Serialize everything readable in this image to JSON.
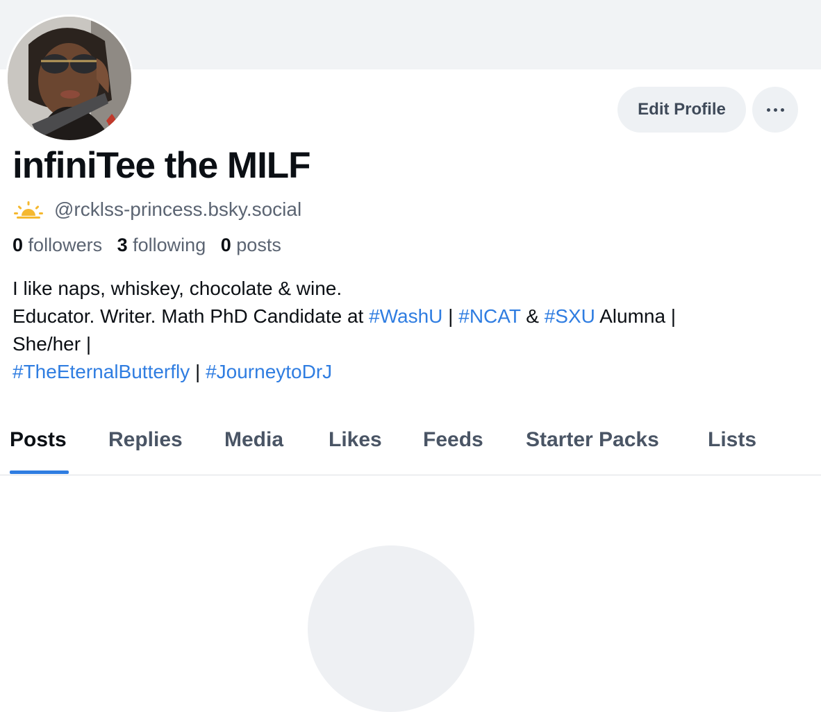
{
  "profile": {
    "display_name": "infiniTee the MILF",
    "handle": "@rcklss-princess.bsky.social",
    "handle_icon": "sun-icon"
  },
  "actions": {
    "edit_label": "Edit Profile",
    "more_icon": "more-dots-icon"
  },
  "stats": {
    "followers_count": "0",
    "followers_label": "followers",
    "following_count": "3",
    "following_label": "following",
    "posts_count": "0",
    "posts_label": "posts"
  },
  "bio": {
    "line1": "I like naps, whiskey, chocolate & wine.",
    "l2_a": "Educator. Writer. Math PhD Candidate at ",
    "tag_washu": "#WashU",
    "l2_b": " | ",
    "tag_ncat": "#NCAT",
    "l2_c": " & ",
    "tag_sxu": "#SXU",
    "l2_d": " Alumna |",
    "line3": "She/her |",
    "tag_butterfly": "#TheEternalButterfly",
    "l4_sep": " | ",
    "tag_journey": "#JourneytoDrJ"
  },
  "tabs": [
    {
      "label": "Posts",
      "active": true
    },
    {
      "label": "Replies",
      "active": false
    },
    {
      "label": "Media",
      "active": false
    },
    {
      "label": "Likes",
      "active": false
    },
    {
      "label": "Feeds",
      "active": false
    },
    {
      "label": "Starter Packs",
      "active": false
    },
    {
      "label": "Lists",
      "active": false
    }
  ],
  "colors": {
    "accent": "#2f7de1",
    "banner": "#f1f3f5",
    "button_bg": "#eef1f4",
    "muted_text": "#5b6472"
  }
}
